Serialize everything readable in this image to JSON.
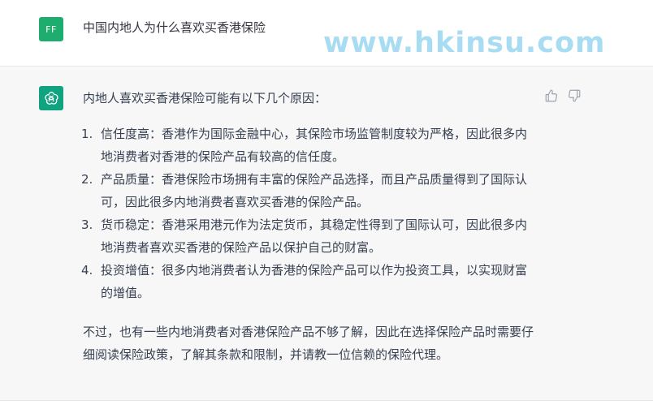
{
  "colors": {
    "user_avatar_bg": "#1ead6f",
    "bot_avatar_bg": "#10a37f",
    "watermark": "#a8dcf2",
    "icon_gray": "#9ca3af"
  },
  "user_message": {
    "avatar_initials": "FF",
    "text": "中国内地人为什么喜欢买香港保险"
  },
  "watermark": "www.hkinsu.com",
  "assistant_message": {
    "avatar_icon": "openai-logo-icon",
    "intro": "内地人喜欢买香港保险可能有以下几个原因：",
    "reasons": [
      {
        "num": "1.",
        "text": "信任度高：香港作为国际金融中心，其保险市场监管制度较为严格，因此很多内地消费者对香港的保险产品有较高的信任度。"
      },
      {
        "num": "2.",
        "text": "产品质量：香港保险市场拥有丰富的保险产品选择，而且产品质量得到了国际认可，因此很多内地消费者喜欢买香港的保险产品。"
      },
      {
        "num": "3.",
        "text": "货币稳定：香港采用港元作为法定货币，其稳定性得到了国际认可，因此很多内地消费者喜欢买香港的保险产品以保护自己的财富。"
      },
      {
        "num": "4.",
        "text": "投资增值：很多内地消费者认为香港的保险产品可以作为投资工具，以实现财富的增值。"
      }
    ],
    "outro": "不过，也有一些内地消费者对香港保险产品不够了解，因此在选择保险产品时需要仔细阅读保险政策，了解其条款和限制，并请教一位信赖的保险代理。",
    "feedback_icons": [
      "thumbs-up-icon",
      "thumbs-down-icon"
    ]
  }
}
